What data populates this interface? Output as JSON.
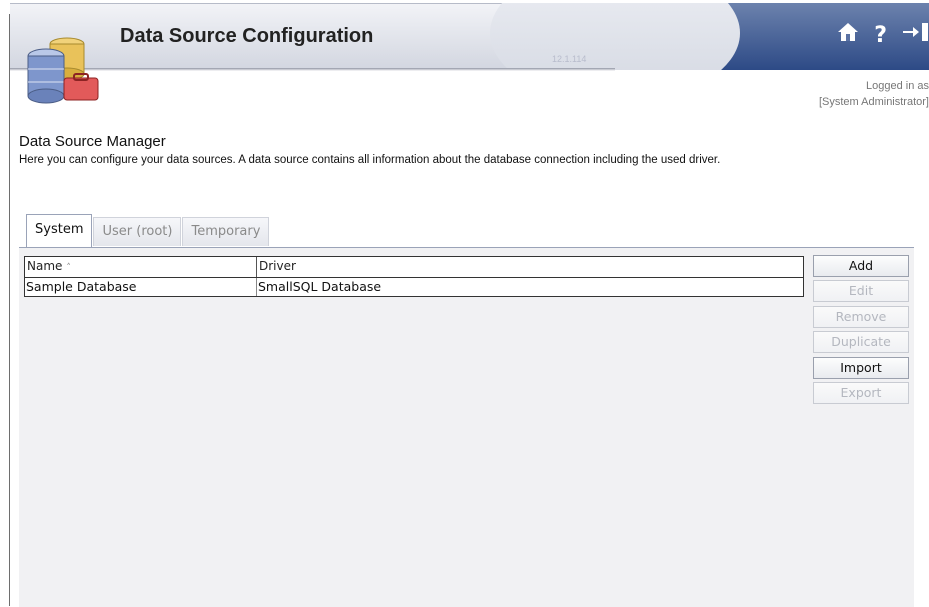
{
  "header": {
    "title": "Data Source Configuration",
    "version": "12.1.114",
    "icons": [
      "home-icon",
      "help-icon",
      "logout-icon"
    ],
    "help_glyph": "?"
  },
  "login": {
    "line1": "Logged in as",
    "line2": "[System Administrator]"
  },
  "page": {
    "title": "Data Source Manager",
    "description": "Here you can configure your data sources. A data source contains all information about the database connection including the used driver."
  },
  "tabs": [
    {
      "label": "System",
      "active": true
    },
    {
      "label": "User (root)",
      "active": false
    },
    {
      "label": "Temporary",
      "active": false
    }
  ],
  "table": {
    "columns": {
      "name": "Name",
      "driver": "Driver"
    },
    "sort_indicator": "˄",
    "rows": [
      {
        "name": "Sample Database",
        "driver": "SmallSQL Database"
      }
    ]
  },
  "buttons": {
    "add": "Add",
    "edit": "Edit",
    "remove": "Remove",
    "duplicate": "Duplicate",
    "import": "Import",
    "export": "Export"
  },
  "colors": {
    "header_dark": "#2d4a86",
    "panel_bg": "#f1f1f3"
  }
}
